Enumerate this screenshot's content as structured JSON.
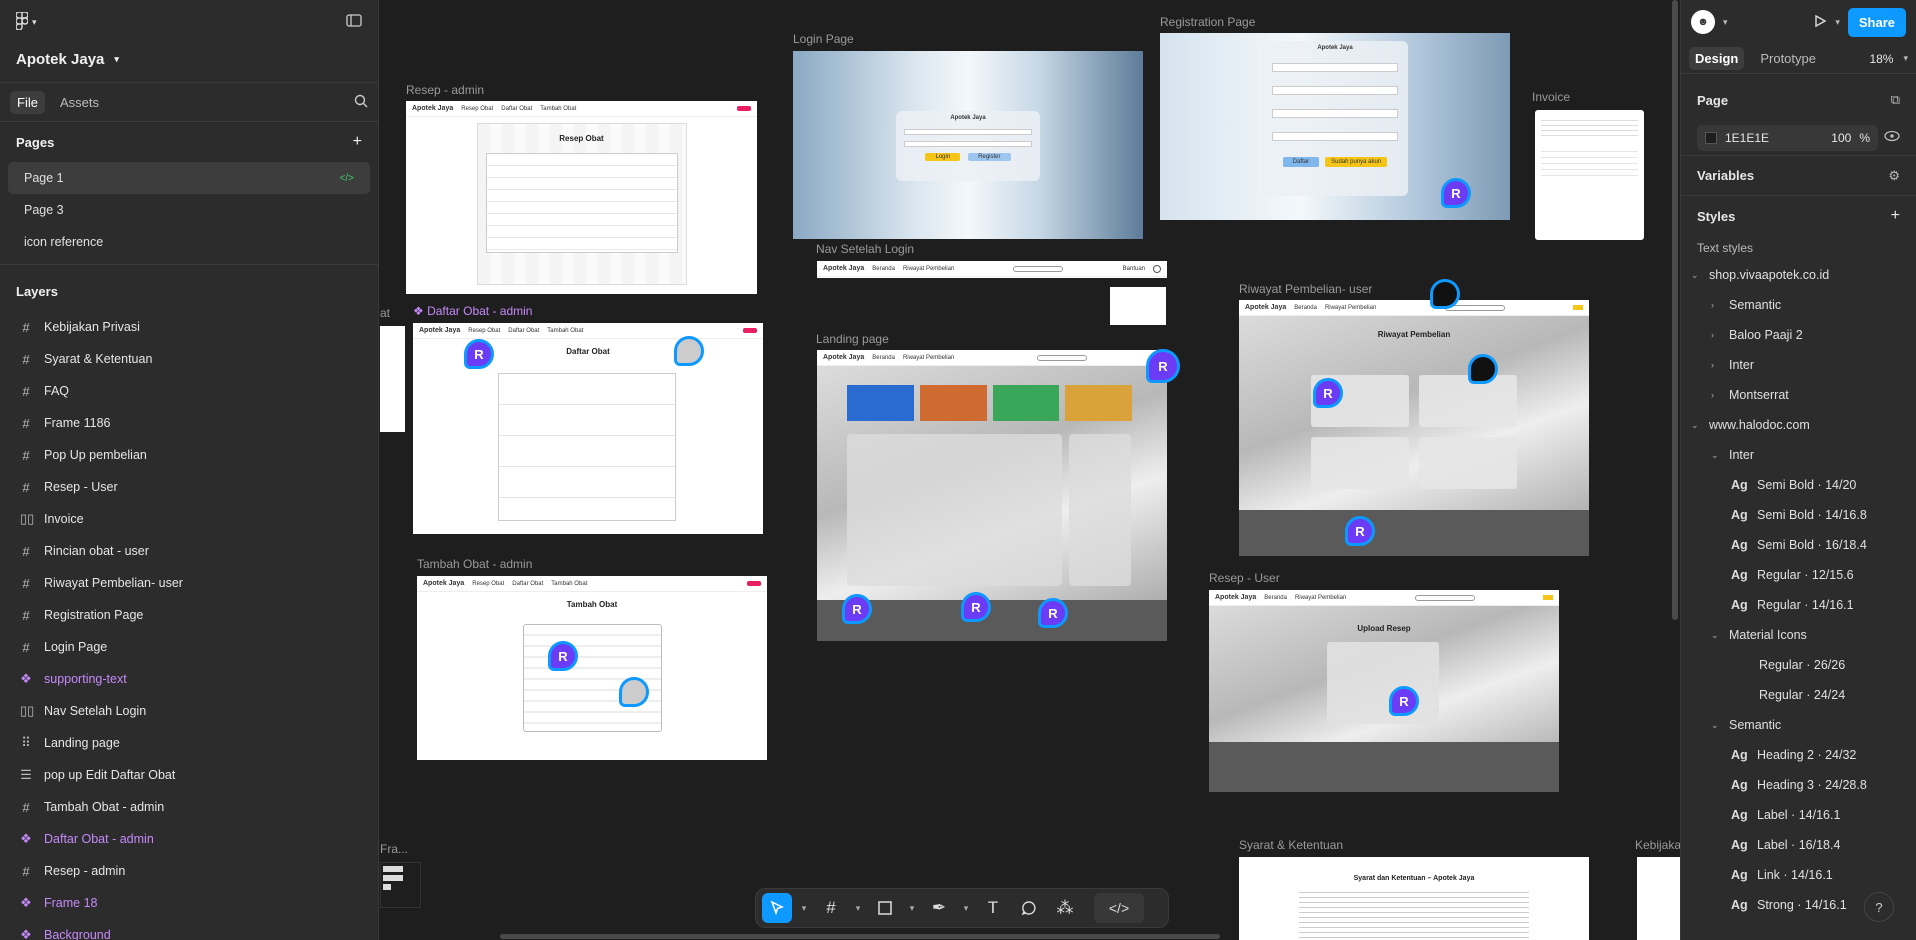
{
  "project": {
    "name": "Apotek Jaya"
  },
  "left_tabs": [
    "File",
    "Assets"
  ],
  "pages": {
    "title": "Pages",
    "items": [
      "Page 1",
      "Page 3",
      "icon reference"
    ]
  },
  "layers": {
    "title": "Layers",
    "items": [
      {
        "label": "Kebijakan Privasi",
        "type": "frame"
      },
      {
        "label": "Syarat & Ketentuan",
        "type": "frame"
      },
      {
        "label": "FAQ",
        "type": "frame"
      },
      {
        "label": "Frame 1186",
        "type": "frame"
      },
      {
        "label": "Pop Up pembelian",
        "type": "frame"
      },
      {
        "label": "Resep - User",
        "type": "frame"
      },
      {
        "label": "Invoice",
        "type": "autolayout"
      },
      {
        "label": "Rincian obat - user",
        "type": "frame"
      },
      {
        "label": "Riwayat Pembelian- user",
        "type": "frame"
      },
      {
        "label": "Registration Page",
        "type": "frame"
      },
      {
        "label": "Login Page",
        "type": "frame"
      },
      {
        "label": "supporting-text",
        "type": "component"
      },
      {
        "label": "Nav Setelah Login",
        "type": "autolayout"
      },
      {
        "label": "Landing page",
        "type": "grid"
      },
      {
        "label": "pop up Edit Daftar Obat",
        "type": "autolayout2"
      },
      {
        "label": "Tambah Obat - admin",
        "type": "frame"
      },
      {
        "label": "Daftar Obat - admin",
        "type": "component"
      },
      {
        "label": "Resep - admin",
        "type": "frame"
      },
      {
        "label": "Frame 18",
        "type": "component"
      },
      {
        "label": "Background",
        "type": "component"
      }
    ]
  },
  "right": {
    "share": "Share",
    "tabs": [
      "Design",
      "Prototype"
    ],
    "zoom": "18%",
    "page_section": "Page",
    "page_color": "1E1E1E",
    "page_opacity": "100",
    "percent": "%",
    "variables": "Variables",
    "styles": "Styles",
    "text_styles": "Text styles",
    "groups": [
      {
        "label": "shop.vivaapotek.co.id",
        "level": 0,
        "kind": "group-open"
      },
      {
        "label": "Semantic",
        "level": 1,
        "kind": "group"
      },
      {
        "label": "Baloo Paaji 2",
        "level": 1,
        "kind": "group"
      },
      {
        "label": "Inter",
        "level": 1,
        "kind": "group"
      },
      {
        "label": "Montserrat",
        "level": 1,
        "kind": "group"
      },
      {
        "label": "www.halodoc.com",
        "level": 0,
        "kind": "group-open"
      },
      {
        "label": "Inter",
        "level": 1,
        "kind": "group-open"
      },
      {
        "label": "Semi Bold · 14/20",
        "level": 2,
        "kind": "style"
      },
      {
        "label": "Semi Bold · 14/16.8",
        "level": 2,
        "kind": "style"
      },
      {
        "label": "Semi Bold · 16/18.4",
        "level": 2,
        "kind": "style"
      },
      {
        "label": "Regular · 12/15.6",
        "level": 2,
        "kind": "style"
      },
      {
        "label": "Regular · 14/16.1",
        "level": 2,
        "kind": "style"
      },
      {
        "label": "Material Icons",
        "level": 1,
        "kind": "group-open"
      },
      {
        "label": "Regular · 26/26",
        "level": 3,
        "kind": "plain"
      },
      {
        "label": "Regular · 24/24",
        "level": 3,
        "kind": "plain"
      },
      {
        "label": "Semantic",
        "level": 1,
        "kind": "group-open"
      },
      {
        "label": "Heading 2 · 24/32",
        "level": 2,
        "kind": "style"
      },
      {
        "label": "Heading 3 · 24/28.8",
        "level": 2,
        "kind": "style"
      },
      {
        "label": "Label · 14/16.1",
        "level": 2,
        "kind": "style"
      },
      {
        "label": "Label · 16/18.4",
        "level": 2,
        "kind": "style"
      },
      {
        "label": "Link · 14/16.1",
        "level": 2,
        "kind": "style"
      },
      {
        "label": "Strong · 14/16.1",
        "level": 2,
        "kind": "style"
      }
    ]
  },
  "canvas": {
    "frames": {
      "resep_admin": "Resep - admin",
      "login": "Login Page",
      "registration": "Registration Page",
      "invoice": "Invoice",
      "nav_setelah": "Nav Setelah Login",
      "daftar_obat": "Daftar Obat - admin",
      "landing": "Landing page",
      "riwayat": "Riwayat Pembelian- user",
      "tambah": "Tambah Obat - admin",
      "resep_user": "Resep - User",
      "syarat": "Syarat & Ketentuan",
      "kebijakan": "Kebijaka",
      "fra": "Fra...",
      "at": "at"
    },
    "inner": {
      "logo": "Apotek Jaya",
      "resep_obat": "Resep Obat",
      "daftar_obat": "Daftar Obat",
      "tambah_obat": "Tambah Obat",
      "riwayat": "Riwayat Pembelian",
      "upload": "Upload Resep",
      "syarat_title": "Syarat dan Ketentuan – Apotek Jaya",
      "login_btn": "Login",
      "register_btn": "Register",
      "daftar_btn": "Daftar",
      "sudah_btn": "Sudah punya akun"
    },
    "cursor_letter": "R"
  }
}
